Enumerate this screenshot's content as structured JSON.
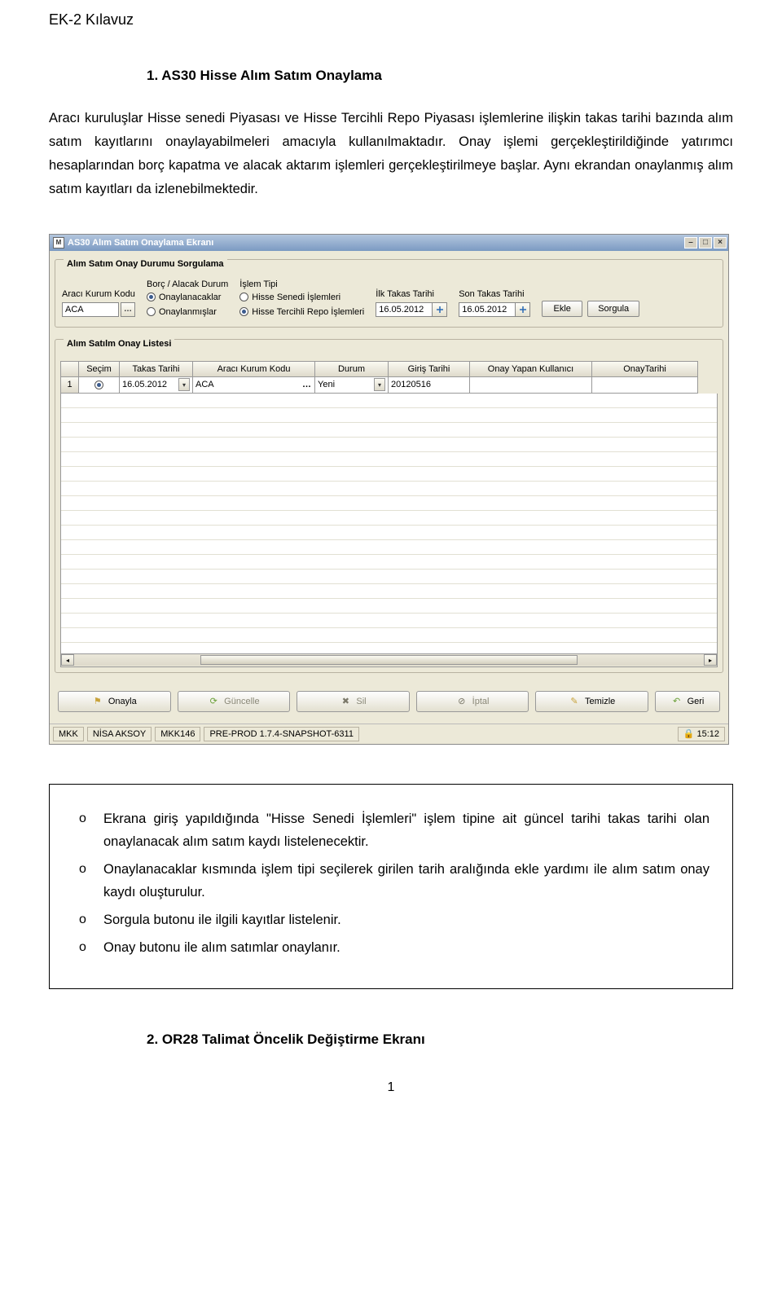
{
  "doc": {
    "header": "EK-2 Kılavuz",
    "section1_title": "1. AS30 Hisse Alım Satım Onaylama",
    "para1": "Aracı kuruluşlar Hisse senedi Piyasası ve Hisse Tercihli Repo Piyasası işlemlerine ilişkin takas tarihi bazında alım satım kayıtlarını onaylayabilmeleri amacıyla kullanılmaktadır. Onay işlemi gerçekleştirildiğinde yatırımcı hesaplarından borç kapatma ve alacak aktarım işlemleri gerçekleştirilmeye başlar. Aynı ekrandan onaylanmış alım satım kayıtları da izlenebilmektedir.",
    "section2_title": "2. OR28 Talimat Öncelik Değiştirme Ekranı",
    "page_number": "1"
  },
  "window_title": "AS30 Alım Satım Onaylama Ekranı",
  "group1_title": "Alım Satım Onay Durumu Sorgulama",
  "group2_title": "Alım Satılm Onay Listesi",
  "labels": {
    "araci_kurum": "Aracı Kurum Kodu",
    "borc_alacak": "Borç / Alacak Durum",
    "islem_tipi": "İşlem Tipi",
    "ilk_takas": "İlk Takas Tarihi",
    "son_takas": "Son Takas Tarihi"
  },
  "fields": {
    "araci_kurum_value": "ACA",
    "ilk_takas_value": "16.05.2012",
    "son_takas_value": "16.05.2012"
  },
  "radios": {
    "onaylanacaklar": "Onaylanacaklar",
    "onaylanmislar": "Onaylanmışlar",
    "hisse_senedi": "Hisse Senedi İşlemleri",
    "hisse_tercihli": "Hisse Tercihli Repo İşlemleri"
  },
  "buttons": {
    "ekle": "Ekle",
    "sorgula": "Sorgula"
  },
  "grid_headers": {
    "secim": "Seçim",
    "takas_tarihi": "Takas Tarihi",
    "araci_kurum": "Aracı Kurum Kodu",
    "durum": "Durum",
    "giris_tarihi": "Giriş Tarihi",
    "onay_user": "Onay Yapan Kullanıcı",
    "onay_tarihi": "OnayTarihi"
  },
  "grid_row1": {
    "num": "1",
    "takas": "16.05.2012",
    "kod": "ACA",
    "durum": "Yeni",
    "giris": "20120516",
    "user": "",
    "onay": ""
  },
  "bottom_buttons": {
    "onayla": "Onayla",
    "guncelle": "Güncelle",
    "sil": "Sil",
    "iptal": "İptal",
    "temizle": "Temizle",
    "geri": "Geri"
  },
  "status": {
    "s1": "MKK",
    "s2": "NİSA AKSOY",
    "s3": "MKK146",
    "s4": "PRE-PROD 1.7.4-SNAPSHOT-6311",
    "time": "15:12"
  },
  "notes": {
    "n1": "Ekrana giriş yapıldığında \"Hisse Senedi İşlemleri\" işlem tipine ait güncel tarihi takas tarihi olan onaylanacak alım satım kaydı listelenecektir.",
    "n2": "Onaylanacaklar kısmında işlem tipi seçilerek girilen tarih aralığında ekle yardımı ile alım satım onay kaydı oluşturulur.",
    "n3": "Sorgula butonu ile ilgili kayıtlar listelenir.",
    "n4": "Onay butonu ile alım satımlar onaylanır."
  }
}
